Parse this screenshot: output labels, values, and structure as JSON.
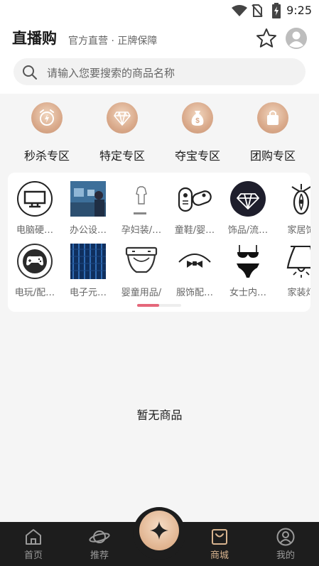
{
  "status_bar": {
    "time": "9:25"
  },
  "header": {
    "title": "直播购",
    "subtitle": "官方直营 · 正牌保障"
  },
  "search": {
    "placeholder": "请输入您要搜索的商品名称"
  },
  "zones": [
    {
      "label": "秒杀专区",
      "icon": "alarm-clock-icon"
    },
    {
      "label": "特定专区",
      "icon": "diamond-icon"
    },
    {
      "label": "夺宝专区",
      "icon": "money-bag-icon"
    },
    {
      "label": "团购专区",
      "icon": "shopping-bag-icon"
    }
  ],
  "categories": [
    {
      "name": "电脑硬…",
      "icon": "monitor-icon"
    },
    {
      "name": "办公设…",
      "icon": "office-photo"
    },
    {
      "name": "孕妇装/…",
      "icon": "maternity-dress-icon"
    },
    {
      "name": "童鞋/婴…",
      "icon": "baby-shoes-icon"
    },
    {
      "name": "饰品/流…",
      "icon": "diamond-icon"
    },
    {
      "name": "家居饰",
      "icon": "home-decor-icon"
    },
    {
      "name": "电玩/配…",
      "icon": "gamepad-icon"
    },
    {
      "name": "电子元…",
      "icon": "electronics-photo"
    },
    {
      "name": "婴童用品/",
      "icon": "diaper-icon"
    },
    {
      "name": "服饰配…",
      "icon": "bow-tie-icon"
    },
    {
      "name": "女士内…",
      "icon": "lingerie-icon"
    },
    {
      "name": "家装灯",
      "icon": "lamp-icon"
    }
  ],
  "scroll_indicator": {
    "progress": 0.5
  },
  "empty_text": "暂无商品",
  "nav": {
    "tabs": [
      {
        "label": "首页",
        "icon": "home-icon"
      },
      {
        "label": "推荐",
        "icon": "planet-icon"
      },
      {
        "label": "商城",
        "icon": "shopping-bag-icon"
      },
      {
        "label": "我的",
        "icon": "user-icon"
      }
    ],
    "active": "商城",
    "fab_icon": "sparkle-icon"
  },
  "colors": {
    "accent_gold": "#d8b48f",
    "indicator_pink": "#e5677a",
    "nav_bg": "#1d1d1d"
  }
}
